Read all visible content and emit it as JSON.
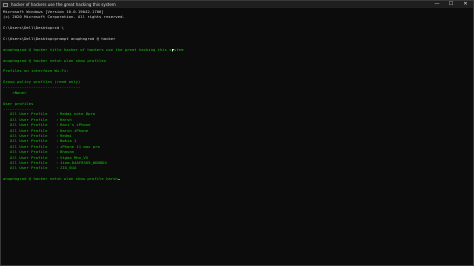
{
  "window": {
    "title": "hacker of hackers use the great hacking this system",
    "minimize": "—",
    "maximize": "☐",
    "close": "✕"
  },
  "console": {
    "header_line1": "Microsoft Windows [Version 10.0.19042.1706]",
    "header_line2": "(c) 2020 Microsoft Corporation. All rights reserved.",
    "prompt1": "C:\\Users\\Dell\\Desktop>cd \\",
    "prompt2": "C:\\Users\\Dell\\Desktop>prompt anuphngrod @ hacker",
    "cmd_title": "anuphngrod @ hacker title hacker of hackers use the great hacking this system",
    "cmd_show_profiles": "anuphngrod @ hacker netsh wlan show profiles",
    "profiles_on_iface": "Profiles on interface Wi-Fi:",
    "group_policy": "Group policy profiles (read only)",
    "group_policy_sep": "---------------------------------",
    "none": "    <None>",
    "user_profiles": "User profiles",
    "user_profiles_sep": "-------------",
    "profiles": [
      {
        "type": "All User Profile",
        "name": "Redmi note 8pro"
      },
      {
        "type": "All User Profile",
        "name": "Harsh"
      },
      {
        "type": "All User Profile",
        "name": "Ravi's iPhone"
      },
      {
        "type": "All User Profile",
        "name": "Harsh iPhone"
      },
      {
        "type": "All User Profile",
        "name": "Redmi"
      },
      {
        "type": "All User Profile",
        "name": "Nokia 1"
      },
      {
        "type": "All User Profile",
        "name": "iPhone 11 max pro"
      },
      {
        "type": "All User Profile",
        "name": "Bhavan"
      },
      {
        "type": "All User Profile",
        "name": "Vigoo Mhx_VG"
      },
      {
        "type": "All User Profile",
        "name": "Jiom-D4AF8309_0DB8D4"
      },
      {
        "type": "All User Profile",
        "name": "JIO_B1A"
      }
    ],
    "cmd_show_profile": "anuphngrod @ hacker netsh wlan show profile harsh"
  }
}
